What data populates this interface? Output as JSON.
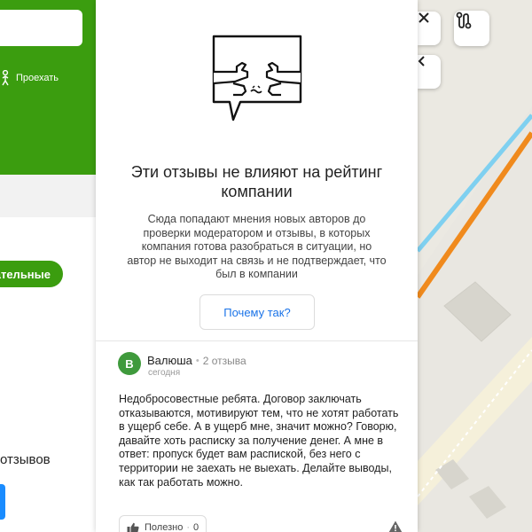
{
  "left": {
    "route_label": "Проехать",
    "pill_label": "ательные",
    "count_label": "отзывов"
  },
  "card": {
    "headline": "Эти отзывы не влияют на рейтинг компании",
    "description": "Сюда попадают мнения новых авторов до проверки модератором и отзывы, в которых компания готова разобраться в ситуации, но автор не выходит на связь и не подтверждает, что был в компании",
    "why_button": "Почему так?"
  },
  "review": {
    "avatar_letter": "В",
    "author": "Валюша",
    "reviews_count": "2 отзыва",
    "date": "сегодня",
    "text": "Недобросовестные ребята. Договор заключать отказываются, мотивируют тем, что не хотят работать в ущерб себе. А в ущерб мне, значит можно? Говорю, давайте хоть расписку за получение денег. А мне в ответ: пропуск будет вам распиской, без него с территории не заехать не выехать. Делайте выводы, как так работать можно.",
    "useful_label": "Полезно",
    "useful_count": "0"
  },
  "map": {
    "close_icon": "close-icon",
    "route_icon": "route-icon",
    "collapse_icon": "chevron-left-icon"
  },
  "colors": {
    "brand_green": "#3b9d0f",
    "link_blue": "#1a73e8",
    "avatar_green": "#3f9a3c",
    "road_orange": "#f08a1d",
    "road_blue": "#7fd0f0"
  }
}
